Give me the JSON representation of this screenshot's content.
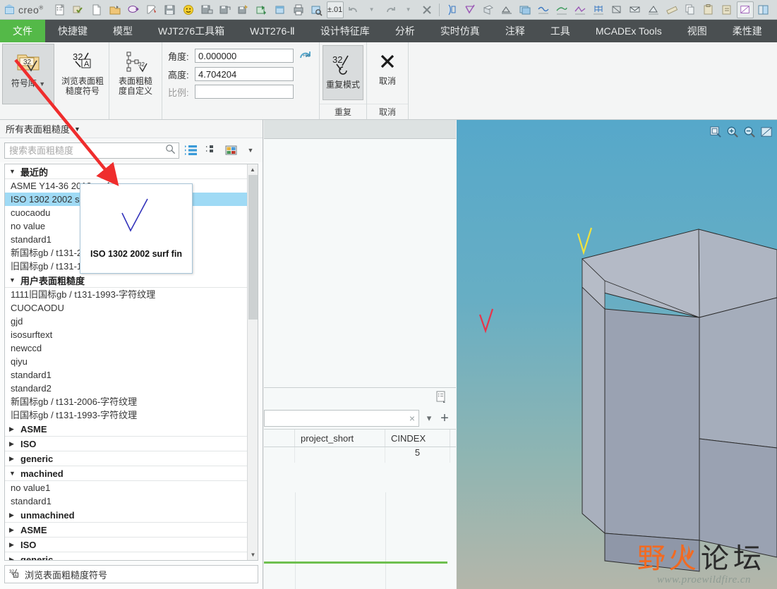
{
  "app": {
    "brand": "creo",
    "brand_sup": "®"
  },
  "quick_access": {
    "icons": [
      {
        "name": "model-properties-icon",
        "label": "模型属性"
      },
      {
        "name": "regenerate-icon",
        "label": "重新生成"
      },
      {
        "name": "new-file-icon",
        "label": "新建"
      },
      {
        "name": "open-file-icon",
        "label": "打开"
      },
      {
        "name": "note-icon",
        "label": "注解"
      },
      {
        "name": "paint-icon",
        "label": "外观"
      },
      {
        "name": "save-icon",
        "label": "保存"
      },
      {
        "name": "smiley-icon",
        "label": "表情"
      },
      {
        "name": "save-as-icon",
        "label": "另存为"
      },
      {
        "name": "save-copy-icon",
        "label": "保存副本"
      },
      {
        "name": "save-backup-icon",
        "label": "备份"
      },
      {
        "name": "export-icon",
        "label": "导出"
      },
      {
        "name": "import-icon",
        "label": "导入"
      },
      {
        "name": "print-icon",
        "label": "打印"
      },
      {
        "name": "print-preview-icon",
        "label": "打印预览"
      },
      {
        "name": "tolerance-icon",
        "label": "±.01"
      },
      {
        "name": "undo-icon",
        "label": "撤消"
      },
      {
        "name": "undo-dropdown-icon",
        "label": "撤消列表"
      },
      {
        "name": "redo-icon",
        "label": "重做"
      },
      {
        "name": "redo-dropdown-icon",
        "label": "重做列表"
      },
      {
        "name": "delete-icon",
        "label": "删除"
      },
      {
        "name": "dimension-icon",
        "label": "尺寸"
      },
      {
        "name": "surface-finish-icon",
        "label": "表面粗糙度"
      },
      {
        "name": "datum-plane-icon",
        "label": "基准平面"
      },
      {
        "name": "geom-tol-icon",
        "label": "几何公差"
      },
      {
        "name": "image-layer-icon",
        "label": "图层"
      },
      {
        "name": "curve-measure-icon",
        "label": "曲线测量"
      },
      {
        "name": "surface-measure-icon",
        "label": "曲面测量"
      },
      {
        "name": "angle-measure-icon",
        "label": "角度测量"
      },
      {
        "name": "grid-measure-icon",
        "label": "网格测量"
      },
      {
        "name": "section-icon",
        "label": "剖面"
      },
      {
        "name": "envelope-icon",
        "label": "封套"
      },
      {
        "name": "draft-measure-icon",
        "label": "拔模测量"
      },
      {
        "name": "ruler-icon",
        "label": "标尺"
      },
      {
        "name": "copy-icon",
        "label": "复制"
      },
      {
        "name": "paste-icon",
        "label": "粘贴"
      },
      {
        "name": "paste-special-icon",
        "label": "选择性粘贴"
      },
      {
        "name": "display-style-icon",
        "label": "显示样式"
      },
      {
        "name": "book-icon",
        "label": "图册"
      },
      {
        "name": "shade-icon",
        "label": "着色"
      },
      {
        "name": "layer-tree-icon",
        "label": "层树"
      },
      {
        "name": "appearance-gallery-icon",
        "label": "外观库"
      },
      {
        "name": "scene-icon",
        "label": "场景"
      },
      {
        "name": "perspective-icon",
        "label": "透视"
      },
      {
        "name": "curve-icon",
        "label": "曲线"
      }
    ],
    "tolerance_label": "±.01"
  },
  "tabs": [
    {
      "label": "文件",
      "active": true
    },
    {
      "label": "快捷键",
      "active": false
    },
    {
      "label": "模型",
      "active": false
    },
    {
      "label": "WJT276工具箱",
      "active": false
    },
    {
      "label": "WJT276-Ⅱ",
      "active": false
    },
    {
      "label": "设计特征库",
      "active": false
    },
    {
      "label": "分析",
      "active": false
    },
    {
      "label": "实时仿真",
      "active": false
    },
    {
      "label": "注释",
      "active": false
    },
    {
      "label": "工具",
      "active": false
    },
    {
      "label": "MCADEx Tools",
      "active": false
    },
    {
      "label": "视图",
      "active": false
    },
    {
      "label": "柔性建",
      "active": false
    }
  ],
  "ribbon": {
    "symbol_library": {
      "label": "符号库",
      "icon_text": "32",
      "has_dropdown": true,
      "selected": true
    },
    "browse_symbol": {
      "label_line1": "浏览表面粗",
      "label_line2": "糙度符号",
      "icon_text": "32",
      "icon_sub": "A"
    },
    "custom_symbol": {
      "label_line1": "表面粗糙",
      "label_line2": "度自定义",
      "icon_text": "32"
    },
    "fields": {
      "angle_label": "角度:",
      "angle_value": "0.000000",
      "height_label": "高度:",
      "height_value": "4.704204",
      "scale_label": "比例:",
      "scale_value": "",
      "rotate_icon_label": "+90"
    },
    "repeat": {
      "button_label": "重复模式",
      "group_label": "重复",
      "icon_text": "32",
      "selected": true
    },
    "cancel": {
      "button_label": "取消",
      "group_label": "取消",
      "icon": "×"
    }
  },
  "left_panel": {
    "filter_label": "所有表面粗糙度",
    "search_placeholder": "搜索表面粗糙度",
    "view_icons": [
      {
        "name": "list-view-icon"
      },
      {
        "name": "detail-view-icon"
      },
      {
        "name": "thumbnail-view-icon"
      },
      {
        "name": "view-options-caret-icon"
      }
    ],
    "groups": [
      {
        "name": "最近的",
        "expanded": true,
        "items": [
          {
            "label": "ASME Y14-36 2018 surf fin",
            "selected": false
          },
          {
            "label": "ISO 1302 2002 surf fin",
            "selected": true
          },
          {
            "label": "cuocaodu",
            "selected": false
          },
          {
            "label": "no value",
            "selected": false
          },
          {
            "label": "standard1",
            "selected": false
          },
          {
            "label": "新国标gb / t131-2006-字符纹理",
            "selected": false
          },
          {
            "label": "旧国标gb / t131-1993-字符纹理",
            "selected": false
          }
        ]
      },
      {
        "name": "用户表面粗糙度",
        "expanded": true,
        "items": [
          {
            "label": "1111旧国标gb / t131-1993-字符纹理",
            "selected": false
          },
          {
            "label": "CUOCAODU",
            "selected": false
          },
          {
            "label": "gjd",
            "selected": false
          },
          {
            "label": "isosurftext",
            "selected": false
          },
          {
            "label": "newccd",
            "selected": false
          },
          {
            "label": "qiyu",
            "selected": false
          },
          {
            "label": "standard1",
            "selected": false
          },
          {
            "label": "standard2",
            "selected": false
          },
          {
            "label": "新国标gb / t131-2006-字符纹理",
            "selected": false
          },
          {
            "label": "旧国标gb / t131-1993-字符纹理",
            "selected": false
          }
        ]
      },
      {
        "name": "ASME",
        "expanded": false,
        "items": []
      },
      {
        "name": "ISO",
        "expanded": false,
        "items": []
      },
      {
        "name": "generic",
        "expanded": false,
        "items": []
      },
      {
        "name": "machined",
        "expanded": true,
        "items": [
          {
            "label": "no value1",
            "selected": false
          },
          {
            "label": "standard1",
            "selected": false
          }
        ]
      },
      {
        "name": "unmachined",
        "expanded": false,
        "items": []
      },
      {
        "name": "ASME",
        "expanded": false,
        "items": []
      },
      {
        "name": "ISO",
        "expanded": false,
        "items": []
      },
      {
        "name": "generic",
        "expanded": false,
        "items": []
      }
    ],
    "status": {
      "icon": "browse-surface-finish-icon",
      "label": "浏览表面粗糙度符号"
    }
  },
  "preview_popup": {
    "caption": "ISO 1302 2002 surf fin",
    "symbol_color": "#3333bb"
  },
  "mid_panel": {
    "expand_icon": "table-properties-icon",
    "input_value": "",
    "clear_icon": "×",
    "dropdown_icon": "▾",
    "add_icon": "+",
    "table": {
      "columns": [
        "",
        "project_short",
        "CINDEX"
      ],
      "rows": [
        [
          "",
          "",
          "5"
        ]
      ]
    },
    "divider_color": "#6ec04f"
  },
  "viewport": {
    "tools": [
      {
        "name": "zoom-window-icon"
      },
      {
        "name": "zoom-in-icon"
      },
      {
        "name": "zoom-out-icon"
      },
      {
        "name": "refit-icon"
      }
    ],
    "symbols": [
      {
        "name": "surface-finish-marker-yellow",
        "color": "#f2e33c"
      },
      {
        "name": "surface-finish-marker-red",
        "color": "#e8344a"
      }
    ],
    "background_top": "#56a8ca",
    "background_bottom": "#b4b6aa",
    "model_color": "#9ba4b4"
  },
  "watermark": {
    "text_cn": "野火论坛",
    "url": "www.proewildfire.cn",
    "flame_color": "#f26a21"
  }
}
